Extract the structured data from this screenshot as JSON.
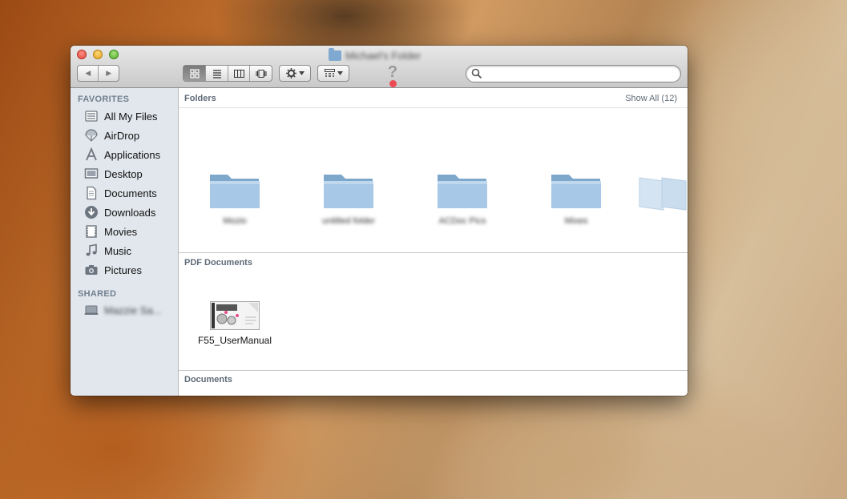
{
  "window": {
    "title": "Michael's Folder"
  },
  "toolbar": {
    "back_glyph": "◀",
    "forward_glyph": "▶",
    "help_glyph": "?",
    "search": {
      "value": "",
      "placeholder": ""
    }
  },
  "sidebar": {
    "favorites_heading": "FAVORITES",
    "items": [
      {
        "label": "All My Files",
        "icon": "all-my-files-icon"
      },
      {
        "label": "AirDrop",
        "icon": "airdrop-icon"
      },
      {
        "label": "Applications",
        "icon": "applications-icon"
      },
      {
        "label": "Desktop",
        "icon": "desktop-icon"
      },
      {
        "label": "Documents",
        "icon": "documents-icon"
      },
      {
        "label": "Downloads",
        "icon": "downloads-icon"
      },
      {
        "label": "Movies",
        "icon": "movies-icon"
      },
      {
        "label": "Music",
        "icon": "music-icon"
      },
      {
        "label": "Pictures",
        "icon": "pictures-icon"
      }
    ],
    "shared_heading": "SHARED",
    "shared_items": [
      {
        "label": "Mazzie Sa...",
        "icon": "computer-icon"
      }
    ]
  },
  "content": {
    "folders": {
      "heading": "Folders",
      "show_all": "Show All (12)",
      "items": [
        {
          "label": "Mozio"
        },
        {
          "label": "untitled folder"
        },
        {
          "label": "ACDoc Pics"
        },
        {
          "label": "Mixes"
        }
      ]
    },
    "pdf": {
      "heading": "PDF Documents",
      "items": [
        {
          "label": "F55_UserManual"
        }
      ]
    },
    "documents": {
      "heading": "Documents",
      "items": [
        {
          "type": "DOCX"
        }
      ]
    }
  },
  "colors": {
    "sidebar_bg": "#e2e7ed",
    "folder_blue": "#8fb7d9",
    "help_dot": "#ec4a53"
  }
}
